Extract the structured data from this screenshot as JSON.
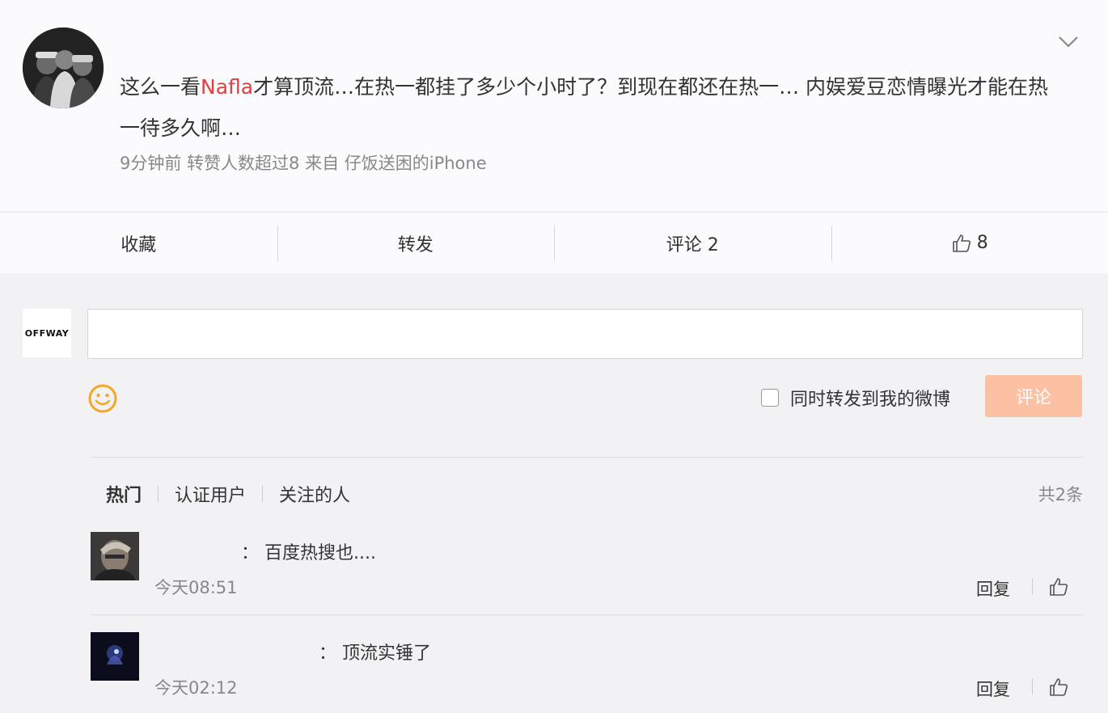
{
  "post": {
    "text_pre": "这么一看",
    "text_highlight": "Nafla",
    "text_post": "才算顶流…在热一都挂了多少个小时了？到现在都还在热一… 内娱爱豆恋情曝光才能在热一待多久啊…",
    "meta": "9分钟前 转赞人数超过8  来自 仔饭送困的iPhone"
  },
  "actions": {
    "favorite": "收藏",
    "repost": "转发",
    "comment": "评论 2",
    "like_count": "8"
  },
  "composer": {
    "avatar_text": "OFFWAY",
    "repost_label": "同时转发到我的微博",
    "submit_label": "评论"
  },
  "filters": {
    "hot": "热门",
    "verified": "认证用户",
    "following": "关注的人",
    "total": "共2条"
  },
  "comments": [
    {
      "text": "：  百度热搜也....",
      "time": "今天08:51",
      "reply": "回复"
    },
    {
      "text": "：  顶流实锤了",
      "time": "今天02:12",
      "reply": "回复"
    }
  ],
  "colors": {
    "highlight": "#e04040",
    "submit_bg": "#fcc1a3",
    "emoji": "#f5a623"
  }
}
